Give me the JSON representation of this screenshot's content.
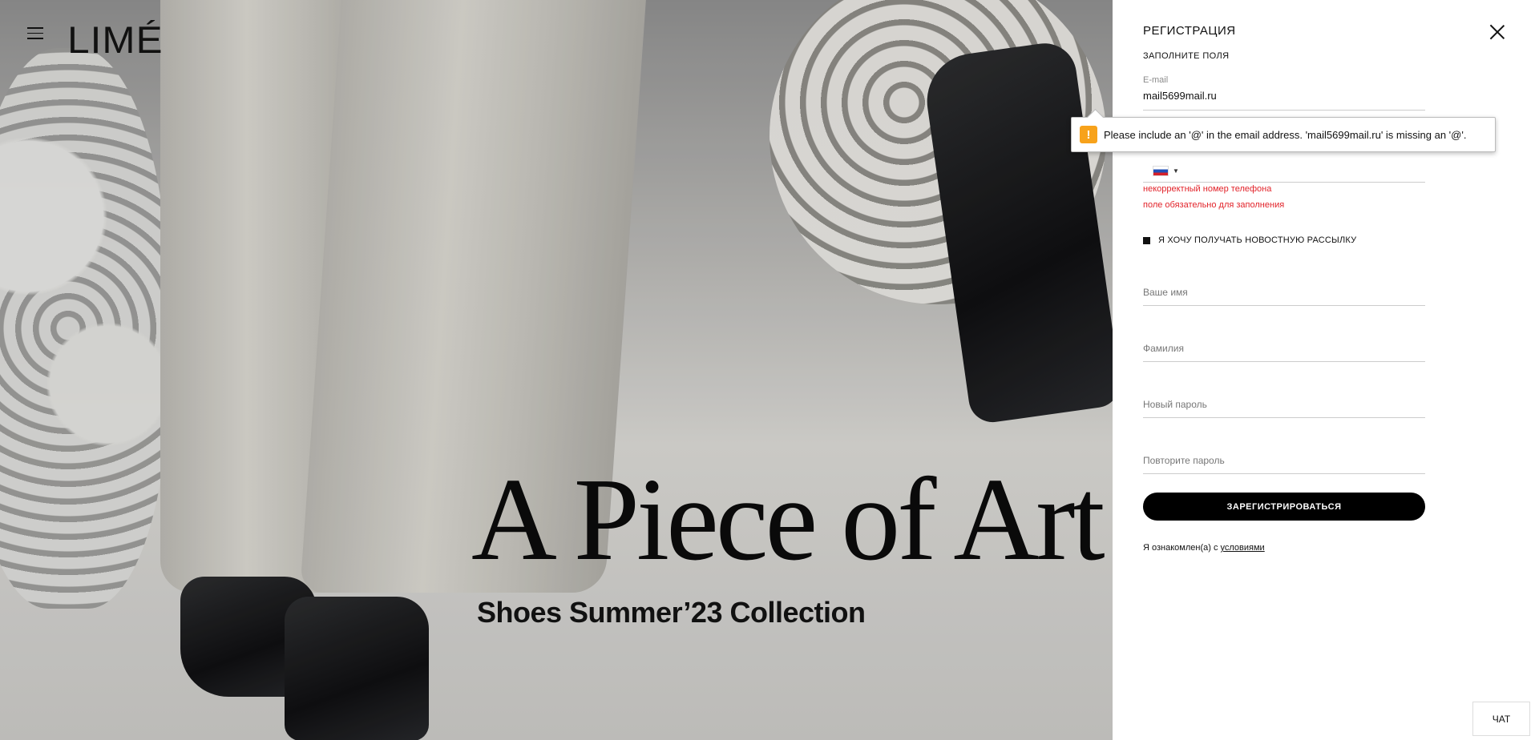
{
  "header": {
    "logo": "LIMÉ"
  },
  "hero": {
    "headline": "A Piece of Art",
    "subline": "Shoes Summer’23 Collection"
  },
  "register": {
    "title": "РЕГИСТРАЦИЯ",
    "subtitle": "ЗАПОЛНИТЕ ПОЛЯ",
    "email_label": "E-mail",
    "email_value": "mail5699mail.ru",
    "phone_errors": [
      "некорректный номер телефона",
      "поле обязательно для заполнения"
    ],
    "newsletter_label": "Я ХОЧУ ПОЛУЧАТЬ НОВОСТНУЮ РАССЫЛКУ",
    "name_placeholder": "Ваше имя",
    "lastname_placeholder": "Фамилия",
    "password_placeholder": "Новый пароль",
    "password_repeat_placeholder": "Повторите пароль",
    "submit_label": "ЗАРЕГИСТРИРОВАТЬСЯ",
    "terms_prefix": "Я ознакомлен(а) с ",
    "terms_link": "условиями"
  },
  "validation_tooltip": {
    "icon": "!",
    "message": "Please include an '@' in the email address. 'mail5699mail.ru' is missing an '@'."
  },
  "chat_label": "ЧАТ"
}
